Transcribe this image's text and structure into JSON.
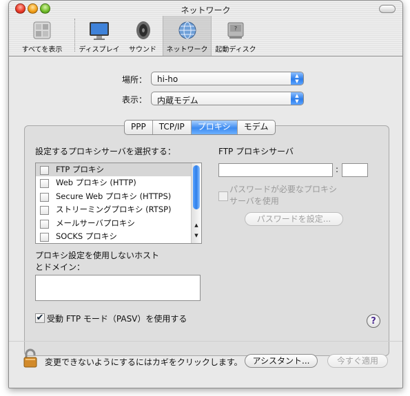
{
  "window": {
    "title": "ネットワーク"
  },
  "toolbar": {
    "items": [
      {
        "label": "すべてを表示",
        "icon": "show-all-icon"
      },
      {
        "label": "ディスプレイ",
        "icon": "display-icon"
      },
      {
        "label": "サウンド",
        "icon": "speaker-icon"
      },
      {
        "label": "ネットワーク",
        "icon": "network-globe-icon"
      },
      {
        "label": "起動ディスク",
        "icon": "startup-disk-icon"
      }
    ],
    "selected": "ネットワーク"
  },
  "location": {
    "label": "場所：",
    "value": "hi-ho"
  },
  "show": {
    "label": "表示：",
    "value": "内蔵モデム"
  },
  "tabs": [
    {
      "label": "PPP",
      "active": false
    },
    {
      "label": "TCP/IP",
      "active": false
    },
    {
      "label": "プロキシ",
      "active": true
    },
    {
      "label": "モデム",
      "active": false
    }
  ],
  "proxy": {
    "select_label": "設定するプロキシサーバを選択する：",
    "list": [
      {
        "label": "FTP プロキシ",
        "checked": false,
        "selected": true
      },
      {
        "label": "Web プロキシ (HTTP)",
        "checked": false,
        "selected": false
      },
      {
        "label": "Secure Web プロキシ (HTTPS)",
        "checked": false,
        "selected": false
      },
      {
        "label": "ストリーミングプロキシ (RTSP)",
        "checked": false,
        "selected": false
      },
      {
        "label": "メールサーバプロキシ",
        "checked": false,
        "selected": false
      },
      {
        "label": "SOCKS プロキシ",
        "checked": false,
        "selected": false
      }
    ],
    "server_title": "FTP プロキシサーバ",
    "server_value": "",
    "port_sep": ":",
    "port_value": "",
    "password_line1": "パスワードが必要なプロキシ",
    "password_line2": "サーバを使用",
    "set_password_button": "パスワードを設定...",
    "bypass_line1": "プロキシ設定を使用しないホスト",
    "bypass_line2": "とドメイン：",
    "bypass_value": "",
    "pasv_label": "受動 FTP モード（PASV）を使用する",
    "pasv_checked": true
  },
  "help": {
    "label": "?"
  },
  "footer": {
    "lock_text": "変更できないようにするにはカギをクリックします。",
    "assistant_button": "アシスタント...",
    "apply_button": "今すぐ適用"
  }
}
